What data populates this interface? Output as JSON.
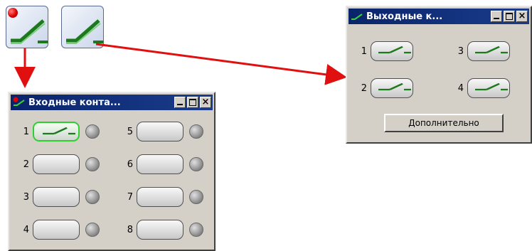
{
  "input_window": {
    "title": "Входные конта...",
    "channels": [
      {
        "num": "1"
      },
      {
        "num": "2"
      },
      {
        "num": "3"
      },
      {
        "num": "4"
      },
      {
        "num": "5"
      },
      {
        "num": "6"
      },
      {
        "num": "7"
      },
      {
        "num": "8"
      }
    ]
  },
  "output_window": {
    "title": "Выходные к...",
    "channels": [
      {
        "num": "1"
      },
      {
        "num": "2"
      },
      {
        "num": "3"
      },
      {
        "num": "4"
      }
    ],
    "more_label": "Дополнительно"
  },
  "colors": {
    "arrow": "#e01010",
    "active_border": "#2fcf2f",
    "titlebar": "#0a246a"
  },
  "icons": {
    "input": "input-contact-icon",
    "output": "output-contact-icon"
  }
}
